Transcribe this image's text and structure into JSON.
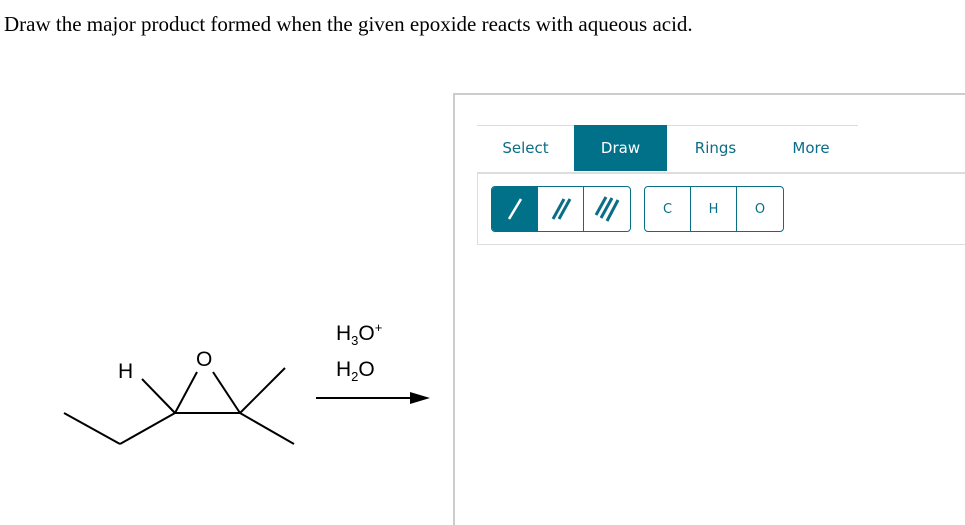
{
  "question": "Draw the major product formed when the given epoxide reacts with aqueous acid.",
  "reaction": {
    "atoms": {
      "h": "H",
      "o": "O"
    },
    "reagent1": {
      "base": "H",
      "sub": "3",
      "el": "O",
      "sup": "+"
    },
    "reagent2": {
      "base": "H",
      "sub": "2",
      "el": "O"
    }
  },
  "editor": {
    "tabs": [
      {
        "label": "Select"
      },
      {
        "label": "Draw",
        "active": true
      },
      {
        "label": "Rings"
      },
      {
        "label": "More"
      }
    ],
    "bond_tools": [
      {
        "icon": "single-bond-icon",
        "active": true
      },
      {
        "icon": "double-bond-icon"
      },
      {
        "icon": "triple-bond-icon"
      }
    ],
    "atom_tools": [
      {
        "label": "C"
      },
      {
        "label": "H"
      },
      {
        "label": "O"
      }
    ],
    "accent": "#007189"
  }
}
